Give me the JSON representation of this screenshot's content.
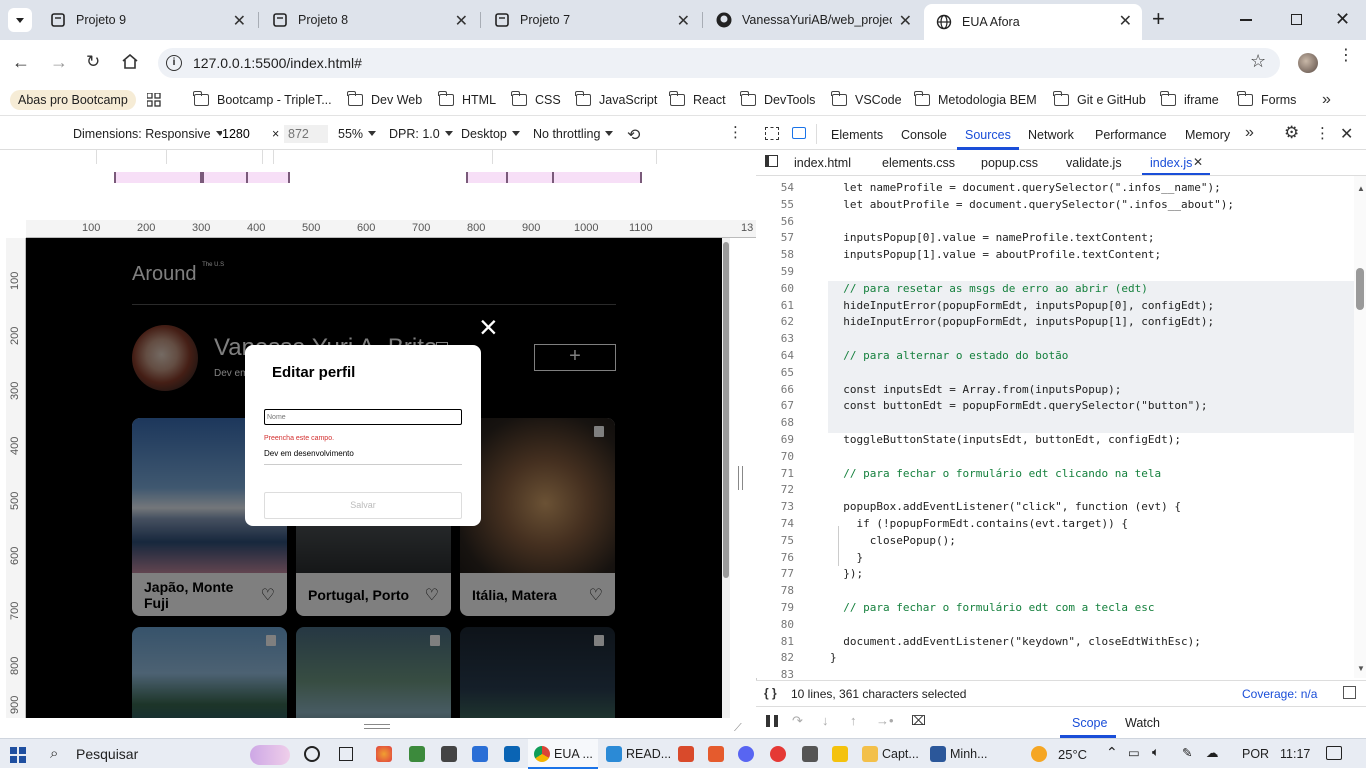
{
  "browser": {
    "tabs": [
      {
        "title": "Projeto 9",
        "active": false
      },
      {
        "title": "Projeto 8",
        "active": false
      },
      {
        "title": "Projeto 7",
        "active": false
      },
      {
        "title": "VanessaYuriAB/web_project_",
        "active": false
      },
      {
        "title": "EUA Afora",
        "active": true
      }
    ],
    "url": "127.0.0.1:5500/index.html#",
    "bookmarks": [
      "Abas pro Bootcamp",
      "Bootcamp - TripleT...",
      "Dev Web",
      "HTML",
      "CSS",
      "JavaScript",
      "React",
      "DevTools",
      "VSCode",
      "Metodologia BEM",
      "Git e GitHub",
      "iframe",
      "Forms"
    ]
  },
  "device_toolbar": {
    "dimensions_label": "Dimensions: Responsive",
    "width": "1280",
    "times": "×",
    "height_placeholder": "872",
    "zoom": "55%",
    "dpr": "DPR: 1.0",
    "mode": "Desktop",
    "throttling": "No throttling"
  },
  "ruler": {
    "top": [
      "100",
      "200",
      "300",
      "400",
      "500",
      "600",
      "700",
      "800",
      "900",
      "1000",
      "1100",
      "13"
    ],
    "left": [
      "100",
      "200",
      "300",
      "400",
      "500",
      "600",
      "700",
      "800",
      "900"
    ]
  },
  "site": {
    "logo": "Around",
    "logo_sup": "The U.S",
    "profile_name": "Vanessa Yuri A. Brito",
    "profile_about": "Dev em desenvolvimento",
    "add_button": "+",
    "cards": [
      {
        "title": "Japão, Monte Fuji"
      },
      {
        "title": "Portugal, Porto"
      },
      {
        "title": "Itália, Matera"
      },
      {
        "title": ""
      },
      {
        "title": ""
      },
      {
        "title": ""
      }
    ]
  },
  "modal": {
    "title": "Editar perfil",
    "name_placeholder": "Nome",
    "name_value": "",
    "error": "Preencha este campo.",
    "about_value": "Dev em desenvolvimento",
    "submit": "Salvar",
    "close": "×"
  },
  "devtools": {
    "tabs": [
      "Elements",
      "Console",
      "Sources",
      "Network",
      "Performance",
      "Memory"
    ],
    "active_tab": "Sources",
    "files": [
      "index.html",
      "elements.css",
      "popup.css",
      "validate.js",
      "index.js"
    ],
    "active_file": "index.js",
    "code": [
      {
        "n": "54",
        "t": "  let nameProfile = document.querySelector(\".infos__name\");"
      },
      {
        "n": "55",
        "t": "  let aboutProfile = document.querySelector(\".infos__about\");"
      },
      {
        "n": "56",
        "t": ""
      },
      {
        "n": "57",
        "t": "  inputsPopup[0].value = nameProfile.textContent;"
      },
      {
        "n": "58",
        "t": "  inputsPopup[1].value = aboutProfile.textContent;"
      },
      {
        "n": "59",
        "t": ""
      },
      {
        "n": "60",
        "t": "  // para resetar as msgs de erro ao abrir (edt)"
      },
      {
        "n": "61",
        "t": "  hideInputError(popupFormEdt, inputsPopup[0], configEdt);"
      },
      {
        "n": "62",
        "t": "  hideInputError(popupFormEdt, inputsPopup[1], configEdt);"
      },
      {
        "n": "63",
        "t": ""
      },
      {
        "n": "64",
        "t": "  // para alternar o estado do botão"
      },
      {
        "n": "65",
        "t": ""
      },
      {
        "n": "66",
        "t": "  const inputsEdt = Array.from(inputsPopup);"
      },
      {
        "n": "67",
        "t": "  const buttonEdt = popupFormEdt.querySelector(\"button\");"
      },
      {
        "n": "68",
        "t": ""
      },
      {
        "n": "69",
        "t": "  toggleButtonState(inputsEdt, buttonEdt, configEdt);"
      },
      {
        "n": "70",
        "t": ""
      },
      {
        "n": "71",
        "t": "  // para fechar o formulário edt clicando na tela"
      },
      {
        "n": "72",
        "t": ""
      },
      {
        "n": "73",
        "t": "  popupBox.addEventListener(\"click\", function (evt) {"
      },
      {
        "n": "74",
        "t": "    if (!popupFormEdt.contains(evt.target)) {"
      },
      {
        "n": "75",
        "t": "      closePopup();"
      },
      {
        "n": "76",
        "t": "    }"
      },
      {
        "n": "77",
        "t": "  });"
      },
      {
        "n": "78",
        "t": ""
      },
      {
        "n": "79",
        "t": "  // para fechar o formulário edt com a tecla esc"
      },
      {
        "n": "80",
        "t": ""
      },
      {
        "n": "81",
        "t": "  document.addEventListener(\"keydown\", closeEdtWithEsc);"
      },
      {
        "n": "82",
        "t": "}"
      },
      {
        "n": "83",
        "t": ""
      }
    ],
    "status": "10 lines, 361 characters selected",
    "coverage": "Coverage: n/a",
    "scope": "Scope",
    "watch": "Watch"
  },
  "taskbar": {
    "search": "Pesquisar",
    "apps": [
      "EUA ...",
      "READ...",
      "Capt...",
      "Minh..."
    ],
    "weather": "25°C",
    "lang": "POR",
    "time": "11:17"
  }
}
